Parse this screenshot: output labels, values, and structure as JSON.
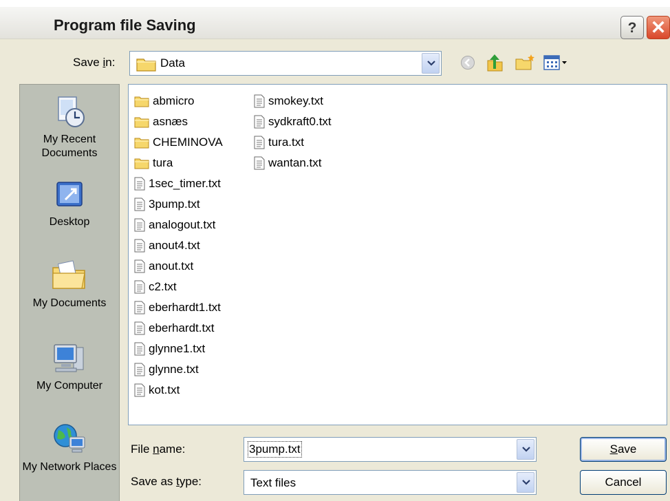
{
  "window": {
    "title": "Program file Saving",
    "help_label": "?",
    "close_label": "✕"
  },
  "toolbar": {
    "save_in_prefix": "Save ",
    "save_in_key": "i",
    "save_in_suffix": "n:",
    "current_folder": "Data"
  },
  "places": [
    {
      "label": "My Recent Documents",
      "icon": "recent-documents-icon"
    },
    {
      "label": "Desktop",
      "icon": "desktop-icon"
    },
    {
      "label": "My Documents",
      "icon": "my-documents-icon"
    },
    {
      "label": "My Computer",
      "icon": "my-computer-icon"
    },
    {
      "label": "My Network Places",
      "icon": "network-places-icon"
    }
  ],
  "files": {
    "column1": [
      {
        "name": "abmicro",
        "type": "folder"
      },
      {
        "name": "asnæs",
        "type": "folder"
      },
      {
        "name": "CHEMINOVA",
        "type": "folder"
      },
      {
        "name": "tura",
        "type": "folder"
      },
      {
        "name": "1sec_timer.txt",
        "type": "file"
      },
      {
        "name": "3pump.txt",
        "type": "file"
      },
      {
        "name": "analogout.txt",
        "type": "file"
      },
      {
        "name": "anout4.txt",
        "type": "file"
      },
      {
        "name": "anout.txt",
        "type": "file"
      },
      {
        "name": "c2.txt",
        "type": "file"
      },
      {
        "name": "eberhardt1.txt",
        "type": "file"
      },
      {
        "name": "eberhardt.txt",
        "type": "file"
      },
      {
        "name": "glynne1.txt",
        "type": "file"
      },
      {
        "name": "glynne.txt",
        "type": "file"
      },
      {
        "name": "kot.txt",
        "type": "file"
      }
    ],
    "column2": [
      {
        "name": "smokey.txt",
        "type": "file"
      },
      {
        "name": "sydkraft0.txt",
        "type": "file"
      },
      {
        "name": "tura.txt",
        "type": "file"
      },
      {
        "name": "wantan.txt",
        "type": "file"
      }
    ]
  },
  "form": {
    "file_name_prefix": "File ",
    "file_name_key": "n",
    "file_name_suffix": "ame:",
    "file_name_value": "3pump.txt",
    "save_type_prefix": "Save as ",
    "save_type_key": "t",
    "save_type_suffix": "ype:",
    "save_type_value": "Text files"
  },
  "buttons": {
    "save_key": "S",
    "save_rest": "ave",
    "cancel": "Cancel"
  },
  "colors": {
    "dialog_bg": "#ece9d8",
    "places_bar": "#bcc0b6",
    "close_button": "#d9472a",
    "combo_border": "#7f9db9",
    "button_border": "#003c74"
  }
}
